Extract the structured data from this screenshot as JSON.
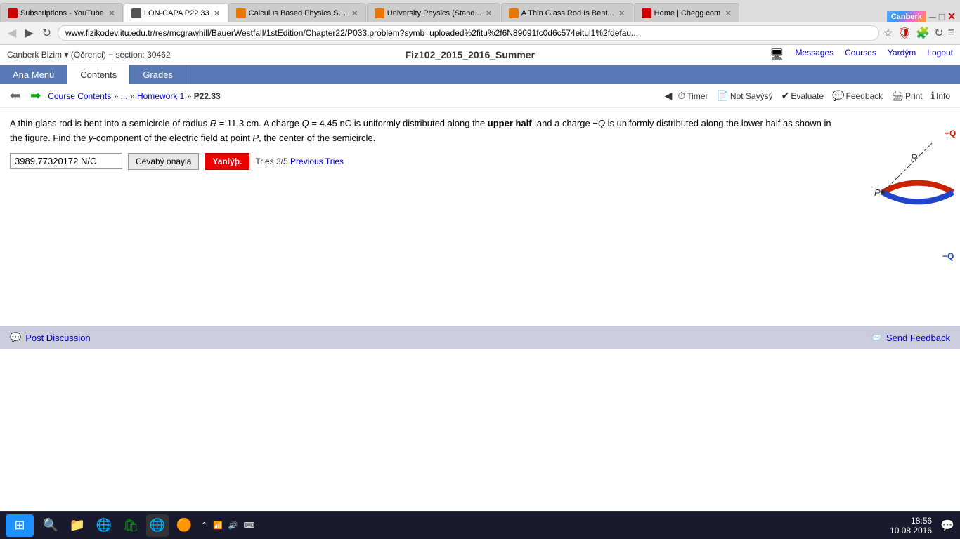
{
  "browser": {
    "tabs": [
      {
        "id": "youtube",
        "title": "Subscriptions - YouTube",
        "favicon_color": "red",
        "active": false
      },
      {
        "id": "loncapa",
        "title": "LON-CAPA P22.33",
        "favicon_color": "#555",
        "active": true
      },
      {
        "id": "calculus",
        "title": "Calculus Based Physics Sc...",
        "favicon_color": "orange",
        "active": false
      },
      {
        "id": "university",
        "title": "University Physics (Stand...",
        "favicon_color": "orange",
        "active": false
      },
      {
        "id": "glassrod",
        "title": "A Thin Glass Rod Is Bent...",
        "favicon_color": "orange",
        "active": false
      },
      {
        "id": "chegg",
        "title": "Home | Chegg.com",
        "favicon_color": "red",
        "active": false
      }
    ],
    "url": "www.fizikodev.itu.edu.tr/res/mcgrawhill/BauerWestfall/1stEdition/Chapter22/P033.problem?symb=uploaded%2fitu%2f6N89091fc0d6c574eitul1%2fdefau...",
    "canberk_label": "Canberk"
  },
  "loncapa": {
    "user": "Canberk Bizim",
    "role": "Öðrenci",
    "section": "section: 30462",
    "course_title": "Fiz102_2015_2016_Summer",
    "header_links": [
      "Messages",
      "Courses",
      "Yardým",
      "Logout"
    ]
  },
  "nav_tabs": [
    {
      "id": "ana-menu",
      "label": "Ana Menü",
      "active": false
    },
    {
      "id": "contents",
      "label": "Contents",
      "active": true
    },
    {
      "id": "grades",
      "label": "Grades",
      "active": false
    }
  ],
  "breadcrumb": {
    "back_disabled": true,
    "links": [
      "Course Contents",
      "...",
      "Homework 1"
    ],
    "current": "P22.33"
  },
  "toolbar": {
    "timer_label": "Timer",
    "notsayisy_label": "Not Sayýsý",
    "evaluate_label": "Evaluate",
    "feedback_label": "Feedback",
    "print_label": "Print",
    "info_label": "Info"
  },
  "problem": {
    "text_part1": "A thin glass rod is bent into a semicircle of radius ",
    "R_label": "R",
    "text_part2": " = 11.3 cm. A charge ",
    "Q_label": "Q",
    "text_part3": " = 4.45 nC is uniformly distributed along the upper half, and a charge −",
    "Q_label2": "Q",
    "text_part4": " is uniformly distributed along the lower half as shown in the figure. Find the ",
    "y_label": "y",
    "text_part5": "-component of the electric field at point ",
    "P_label": "P",
    "text_part6": ", the center of the semicircle.",
    "answer_value": "3989.77320172 N/C",
    "check_button": "Cevabý onayla",
    "wrong_button": "Yanlýþ.",
    "tries_text": "Tries 3/5",
    "previous_tries_label": "Previous Tries"
  },
  "diagram": {
    "plus_q_label": "+Q",
    "minus_q_label": "−Q",
    "R_label": "R",
    "P_label": "P"
  },
  "bottom_bar": {
    "post_discussion_label": "Post Discussion",
    "send_feedback_label": "Send Feedback"
  },
  "taskbar": {
    "time": "18:56",
    "date": "10.08.2016"
  }
}
